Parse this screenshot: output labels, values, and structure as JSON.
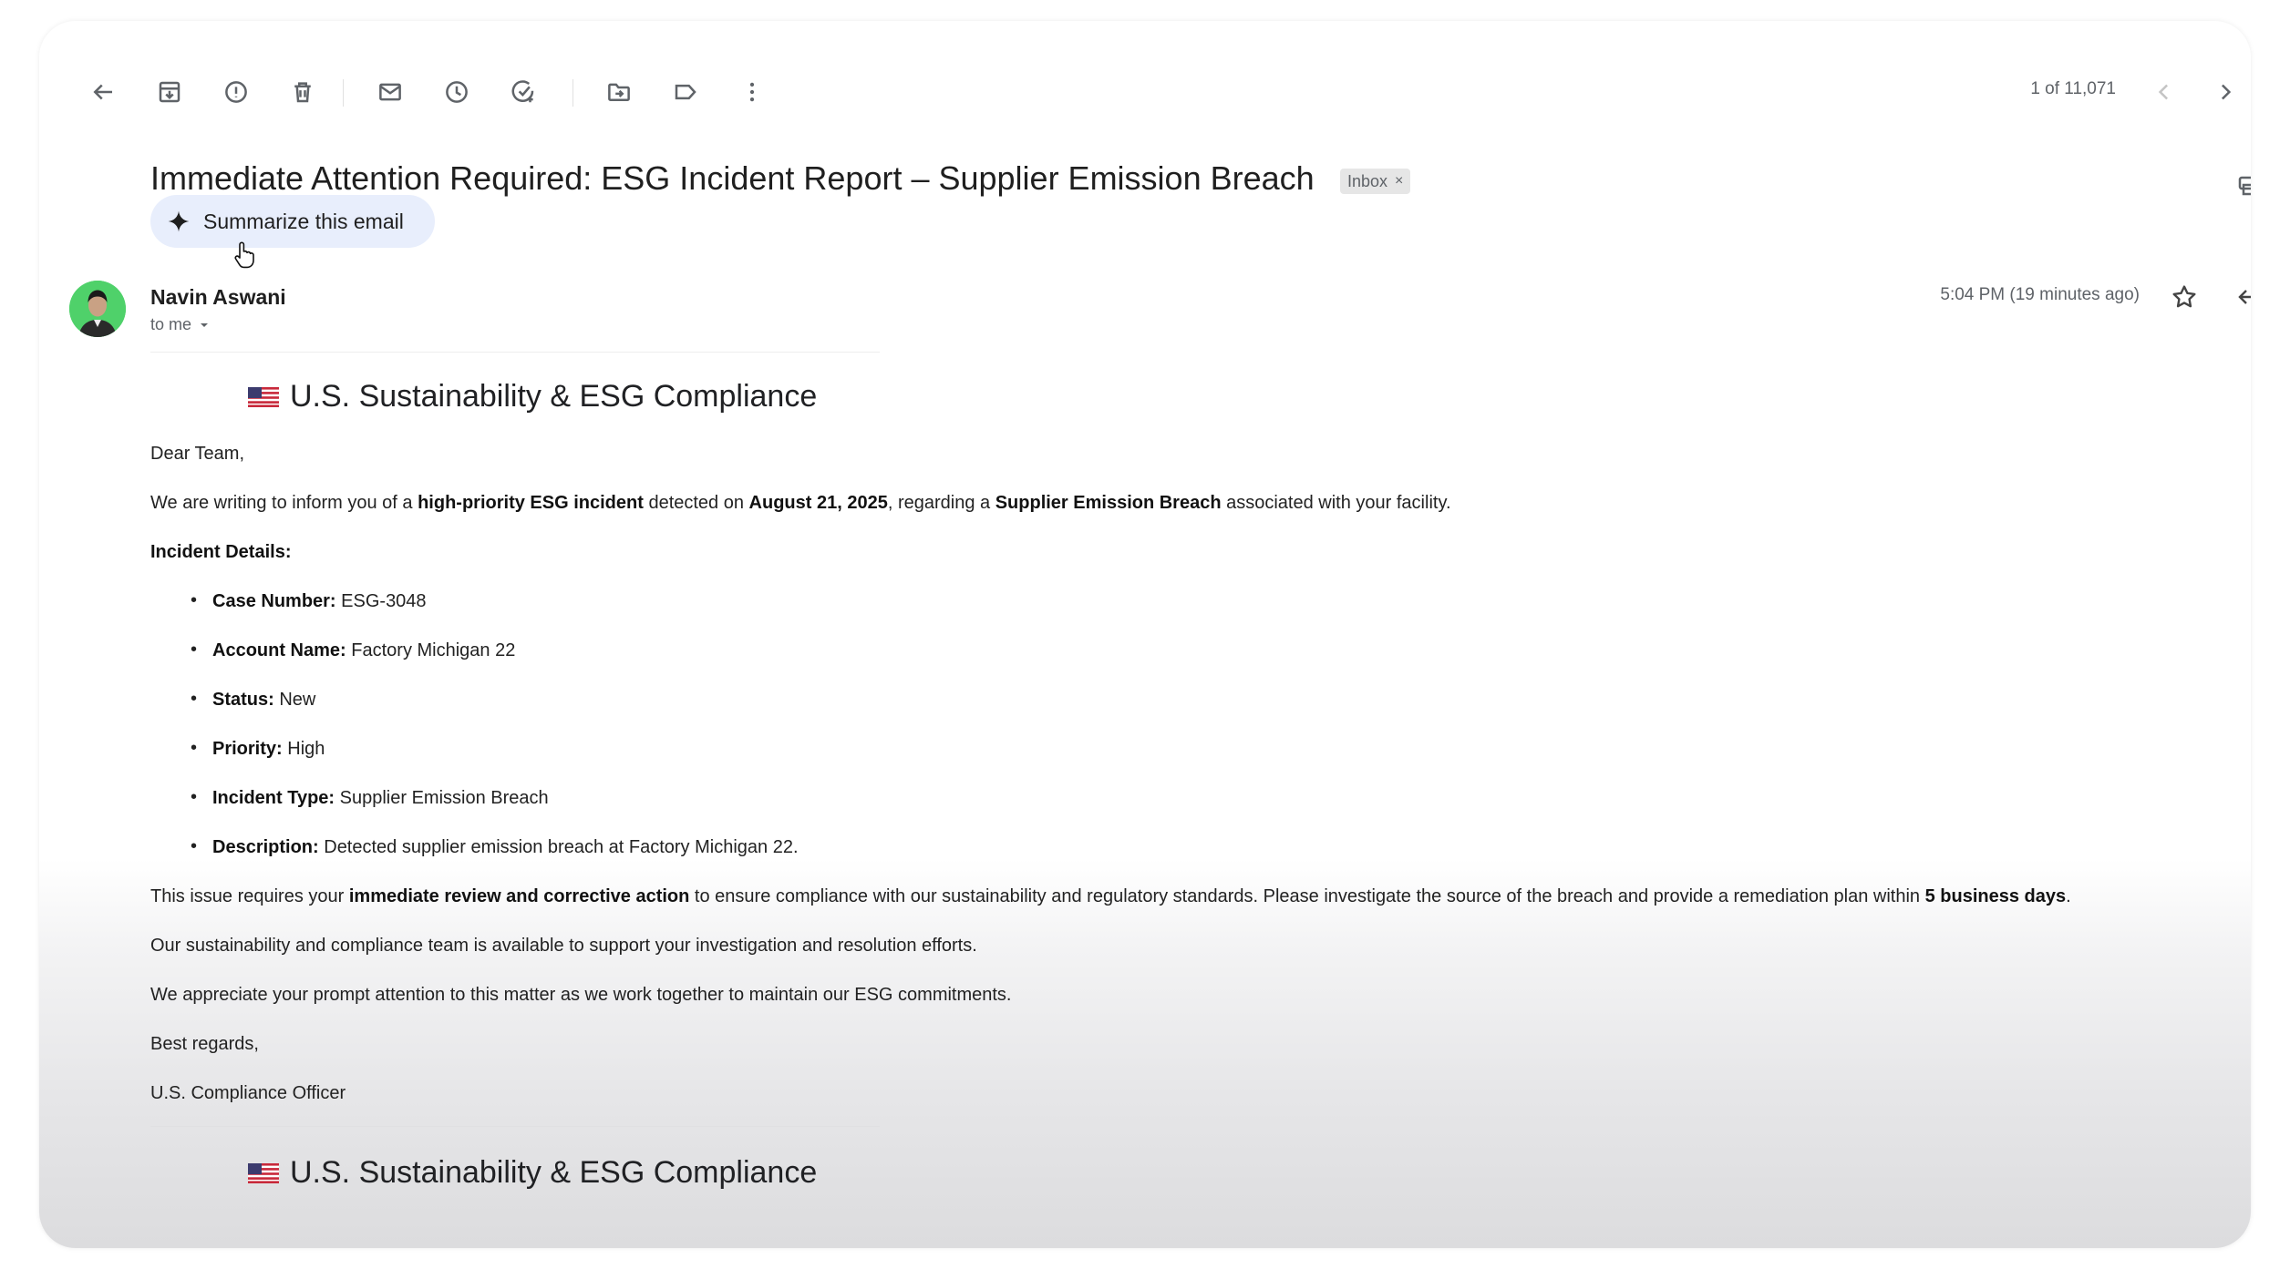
{
  "toolbar": {
    "icons": [
      "back-arrow-icon",
      "archive-icon",
      "report-spam-icon",
      "delete-icon",
      "mark-unread-icon",
      "snooze-icon",
      "add-to-tasks-icon",
      "move-to-icon",
      "label-icon",
      "more-vert-icon"
    ],
    "pager": "1 of 11,071"
  },
  "email": {
    "subject": "Immediate Attention Required: ESG Incident Report – Supplier Emission Breach",
    "label": "Inbox",
    "label_remove": "×",
    "summarize_label": "Summarize this email",
    "sender": "Navin Aswani",
    "to": "to me",
    "time": "5:04 PM (19 minutes ago)"
  },
  "content": {
    "banner_title": "U.S. Sustainability & ESG Compliance",
    "greeting": "Dear Team,",
    "intro": {
      "p1": "We are writing to inform you of a ",
      "b1": "high-priority ESG incident",
      "p2": " detected on ",
      "b2": "August 21, 2025",
      "p3": ", regarding a ",
      "b3": "Supplier Emission Breach",
      "p4": " associated with your facility."
    },
    "details_heading": "Incident Details:",
    "details": [
      {
        "label": "Case Number:",
        "value": " ESG-3048"
      },
      {
        "label": "Account Name:",
        "value": " Factory Michigan 22"
      },
      {
        "label": "Status:",
        "value": " New"
      },
      {
        "label": "Priority:",
        "value": " High"
      },
      {
        "label": "Incident Type:",
        "value": " Supplier Emission Breach"
      },
      {
        "label": "Description:",
        "value": " Detected supplier emission breach at Factory Michigan 22."
      }
    ],
    "action": {
      "p1": "This issue requires your ",
      "b1": "immediate review and corrective action",
      "p2": " to ensure compliance with our sustainability and regulatory standards. Please investigate the source of the breach and provide a remediation plan within ",
      "b2": "5 business days",
      "p3": "."
    },
    "support": "Our sustainability and compliance team is available to support your investigation and resolution efforts.",
    "appreciate": "We appreciate your prompt attention to this matter as we work together to maintain our ESG commitments.",
    "closing": "Best regards,",
    "signature": "U.S. Compliance Officer"
  },
  "colors": {
    "summarize_bg": "#e8eefc",
    "avatar_bg": "#4fd16a"
  }
}
